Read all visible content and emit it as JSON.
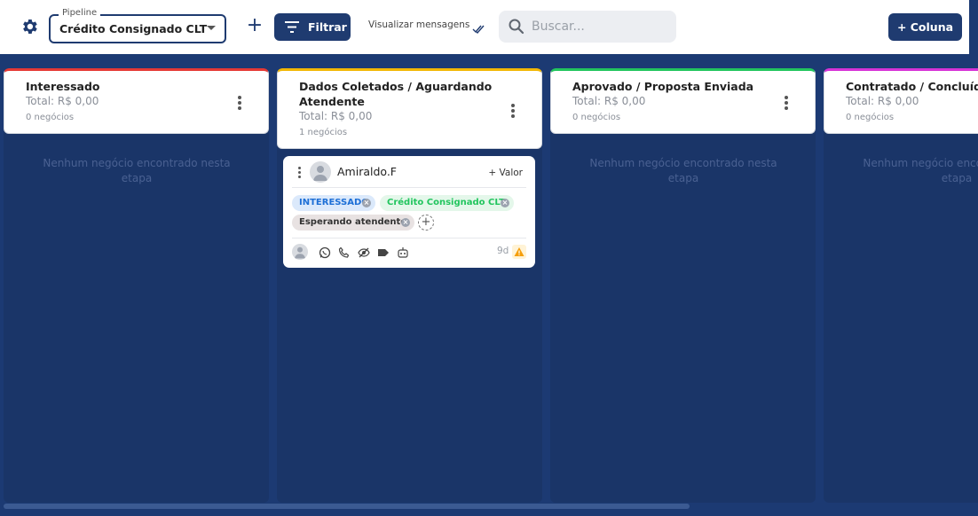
{
  "toolbar": {
    "settings_icon": "gear-icon",
    "pipeline_label": "Pipeline",
    "pipeline_value": "Crédito Consignado CLT",
    "add_icon": "plus-icon",
    "filter_label": "Filtrar",
    "view_messages_label": "Visualizar mensagens",
    "search_placeholder": "Buscar...",
    "add_column_label": "+ Coluna"
  },
  "colors": {
    "primary": "#1f3b70",
    "board_background": "#1c3a73",
    "stage_interessado": "#e53935",
    "stage_dados": "#f2b705",
    "stage_aprovado": "#22c55e",
    "stage_contratado": "#d633d6"
  },
  "columns": [
    {
      "title": "Interessado",
      "total": "Total: R$ 0,00",
      "count": "0 negócios",
      "empty_text": "Nenhum negócio encontrado nesta etapa"
    },
    {
      "title": "Dados Coletados / Aguardando Atendente",
      "total": "Total: R$ 0,00",
      "count": "1 negócios"
    },
    {
      "title": "Aprovado / Proposta Enviada",
      "total": "Total: R$ 0,00",
      "count": "0 negócios",
      "empty_text": "Nenhum negócio encontrado nesta etapa"
    },
    {
      "title": "Contratado / Concluído",
      "total": "Total: R$ 0,00",
      "count": "0 negócios",
      "empty_text": "Nenhum negócio encontrado nesta etapa"
    }
  ],
  "card": {
    "name": "Amiraldo.F",
    "valor_label": "+ Valor",
    "tags": [
      {
        "label": "INTERESSADO",
        "color": "#1d6fd6",
        "bg": "#dbe9fb"
      },
      {
        "label": "Crédito Consignado CLT",
        "color": "#22c55e",
        "bg": "#e4f7ea"
      },
      {
        "label": "Esperando atendente",
        "color": "#333333",
        "bg": "#e8e2e2"
      }
    ],
    "footer_icons": [
      "whatsapp-icon",
      "phone-icon",
      "eye-off-icon",
      "tag-icon",
      "robot-icon"
    ],
    "age": "9d",
    "warning_icon": "warning-icon"
  }
}
